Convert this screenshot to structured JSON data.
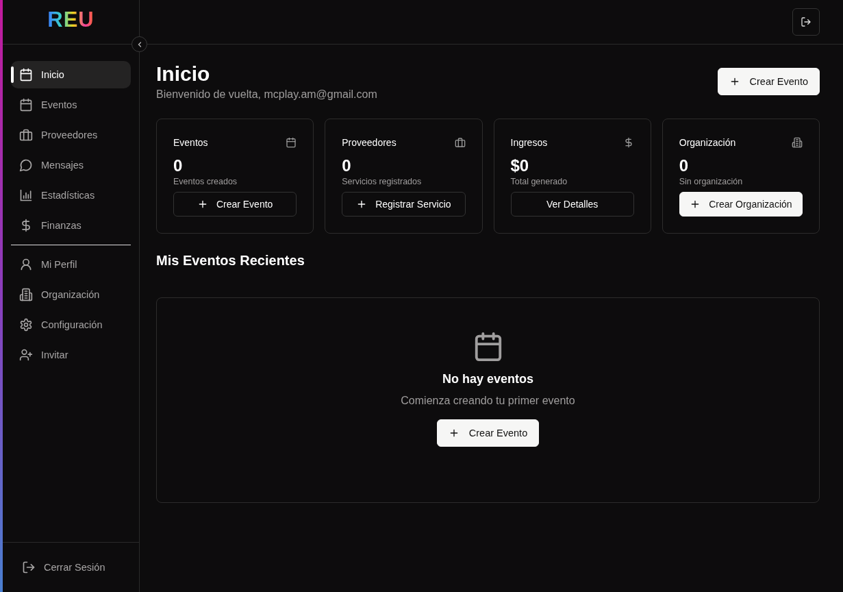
{
  "logo": "REU",
  "sidebar": {
    "main_items": [
      {
        "label": "Inicio",
        "selected": true
      },
      {
        "label": "Eventos",
        "selected": false
      },
      {
        "label": "Proveedores",
        "selected": false
      },
      {
        "label": "Mensajes",
        "selected": false
      },
      {
        "label": "Estadísticas",
        "selected": false
      },
      {
        "label": "Finanzas",
        "selected": false
      }
    ],
    "secondary_items": [
      {
        "label": "Mi Perfil",
        "selected": false
      },
      {
        "label": "Organización",
        "selected": false
      },
      {
        "label": "Configuración",
        "selected": false
      },
      {
        "label": "Invitar",
        "selected": false
      }
    ],
    "logout": "Cerrar Sesión"
  },
  "page": {
    "title": "Inicio",
    "subtitle": "Bienvenido de vuelta, mcplay.am@gmail.com",
    "action": "Crear Evento"
  },
  "cards": [
    {
      "title": "Eventos",
      "value": "0",
      "caption": "Eventos creados",
      "button": {
        "label": "Crear Evento",
        "kind": "outline",
        "plus": true
      }
    },
    {
      "title": "Proveedores",
      "value": "0",
      "caption": "Servicios registrados",
      "button": {
        "label": "Registrar Servicio",
        "kind": "outline",
        "plus": true
      }
    },
    {
      "title": "Ingresos",
      "value": "$0",
      "caption": "Total generado",
      "button": {
        "label": "Ver Detalles",
        "kind": "outline",
        "plus": false
      }
    },
    {
      "title": "Organización",
      "value": "0",
      "caption": "Sin organización",
      "button": {
        "label": "Crear Organización",
        "kind": "primary",
        "plus": true
      }
    }
  ],
  "recent": {
    "title": "Mis Eventos Recientes",
    "empty_title": "No hay eventos",
    "empty_text": "Comienza creando tu primer evento",
    "button": "Crear Evento"
  }
}
